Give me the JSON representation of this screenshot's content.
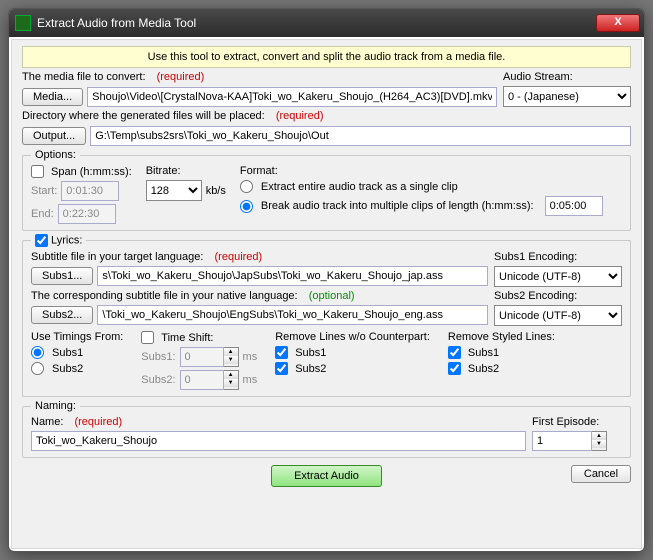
{
  "window": {
    "title": "Extract Audio from Media Tool",
    "close": "X"
  },
  "banner": "Use this tool to extract, convert and split the audio track from a media file.",
  "media": {
    "label": "The media file to convert:",
    "req": "(required)",
    "btn": "Media...",
    "value": "Shoujo\\Video\\[CrystalNova-KAA]Toki_wo_Kakeru_Shoujo_(H264_AC3)[DVD].mkv"
  },
  "audio_stream": {
    "label": "Audio Stream:",
    "value": "0 - (Japanese)"
  },
  "output": {
    "label": "Directory where the generated files will be placed:",
    "req": "(required)",
    "btn": "Output...",
    "value": "G:\\Temp\\subs2srs\\Toki_wo_Kakeru_Shoujo\\Out"
  },
  "options": {
    "legend": "Options:",
    "span": {
      "chk_label": "Span (h:mm:ss):",
      "start_label": "Start:",
      "start": "0:01:30",
      "end_label": "End:",
      "0:22:30": "0:22:30",
      "end": "0:22:30"
    },
    "bitrate": {
      "label": "Bitrate:",
      "value": "128",
      "unit": "kb/s"
    },
    "format": {
      "label": "Format:",
      "opt1": "Extract entire audio track as a single clip",
      "opt2": "Break audio track into multiple clips of length (h:mm:ss):",
      "clip_len": "0:05:00"
    }
  },
  "lyrics": {
    "legend": "Lyrics:",
    "sub1": {
      "label": "Subtitle file in your target language:",
      "req": "(required)",
      "btn": "Subs1...",
      "value": "s\\Toki_wo_Kakeru_Shoujo\\JapSubs\\Toki_wo_Kakeru_Shoujo_jap.ass"
    },
    "enc1": {
      "label": "Subs1 Encoding:",
      "value": "Unicode (UTF-8)"
    },
    "sub2": {
      "label": "The corresponding subtitle file in your native language:",
      "opt": "(optional)",
      "btn": "Subs2...",
      "value": "\\Toki_wo_Kakeru_Shoujo\\EngSubs\\Toki_wo_Kakeru_Shoujo_eng.ass"
    },
    "enc2": {
      "label": "Subs2 Encoding:",
      "value": "Unicode (UTF-8)"
    },
    "timings": {
      "label": "Use Timings From:",
      "o1": "Subs1",
      "o2": "Subs2"
    },
    "shift": {
      "label": "Time Shift:",
      "s1l": "Subs1:",
      "s1v": "0",
      "s2l": "Subs2:",
      "s2v": "0",
      "unit": "ms"
    },
    "remove": {
      "label": "Remove Lines w/o Counterpart:",
      "o1": "Subs1",
      "o2": "Subs2"
    },
    "styled": {
      "label": "Remove Styled Lines:",
      "o1": "Subs1",
      "o2": "Subs2"
    }
  },
  "naming": {
    "legend": "Naming:",
    "name_label": "Name:",
    "req": "(required)",
    "name": "Toki_wo_Kakeru_Shoujo",
    "ep_label": "First Episode:",
    "ep": "1"
  },
  "buttons": {
    "extract": "Extract Audio",
    "cancel": "Cancel"
  }
}
